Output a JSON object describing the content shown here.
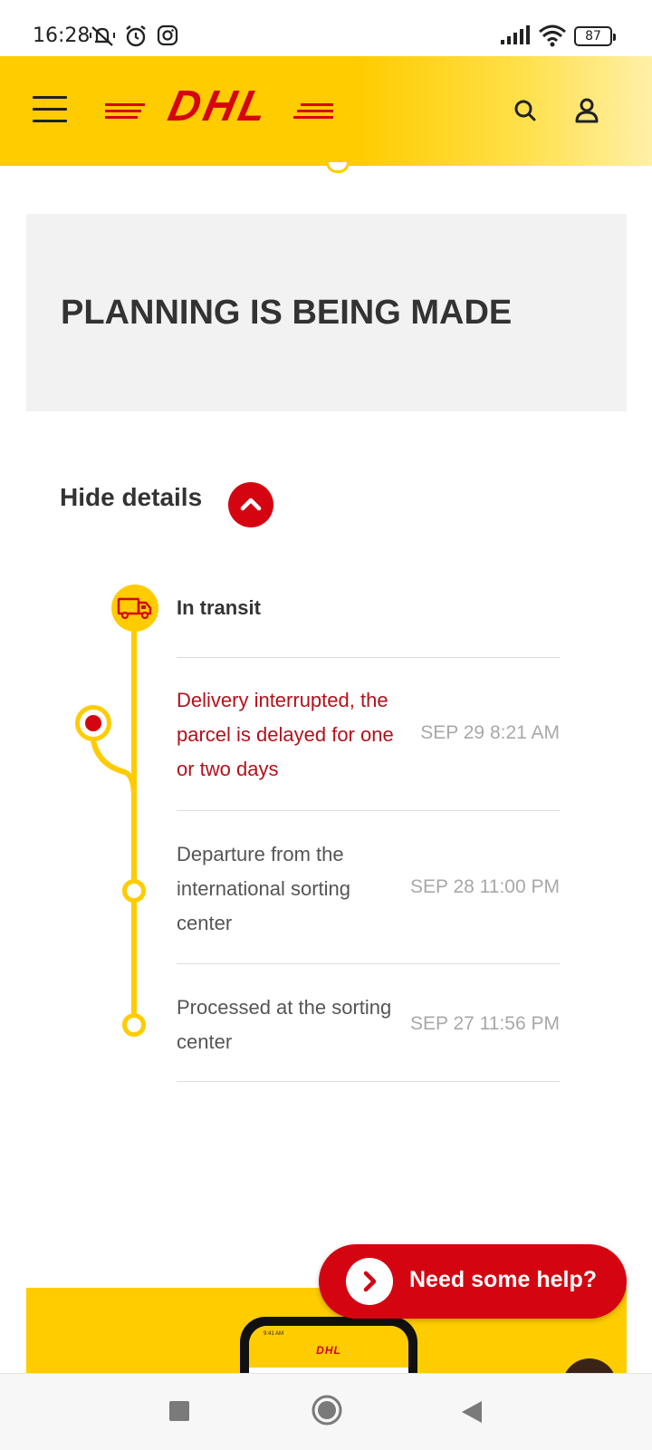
{
  "status_bar": {
    "time": "16:28",
    "battery": "87",
    "icons": [
      "mute-vibrate-icon",
      "alarm-icon",
      "instagram-icon",
      "signal-icon",
      "wifi-icon",
      "battery-icon"
    ]
  },
  "header": {
    "logo_text": "DHL",
    "icons": [
      "menu-icon",
      "search-icon",
      "user-icon"
    ]
  },
  "status": {
    "title": "PLANNING IS BEING MADE"
  },
  "details": {
    "toggle_label": "Hide details"
  },
  "timeline": {
    "group_label": "In transit",
    "events": [
      {
        "description": "Delivery interrupted, the parcel is delayed for one or two days",
        "date": "SEP 29 8:21 AM",
        "alert": true
      },
      {
        "description": "Departure from the international sorting center",
        "date": "SEP 28 11:00 PM",
        "alert": false
      },
      {
        "description": "Processed at the sorting center",
        "date": "SEP 27 11:56 PM",
        "alert": false
      }
    ]
  },
  "help": {
    "label": "Need some help?"
  },
  "promo": {
    "logo_text": "DHL",
    "phone_time": "9:41 AM"
  },
  "colors": {
    "dhl_yellow": "#ffcc00",
    "dhl_red": "#d40511",
    "alert_text": "#b5101b"
  }
}
